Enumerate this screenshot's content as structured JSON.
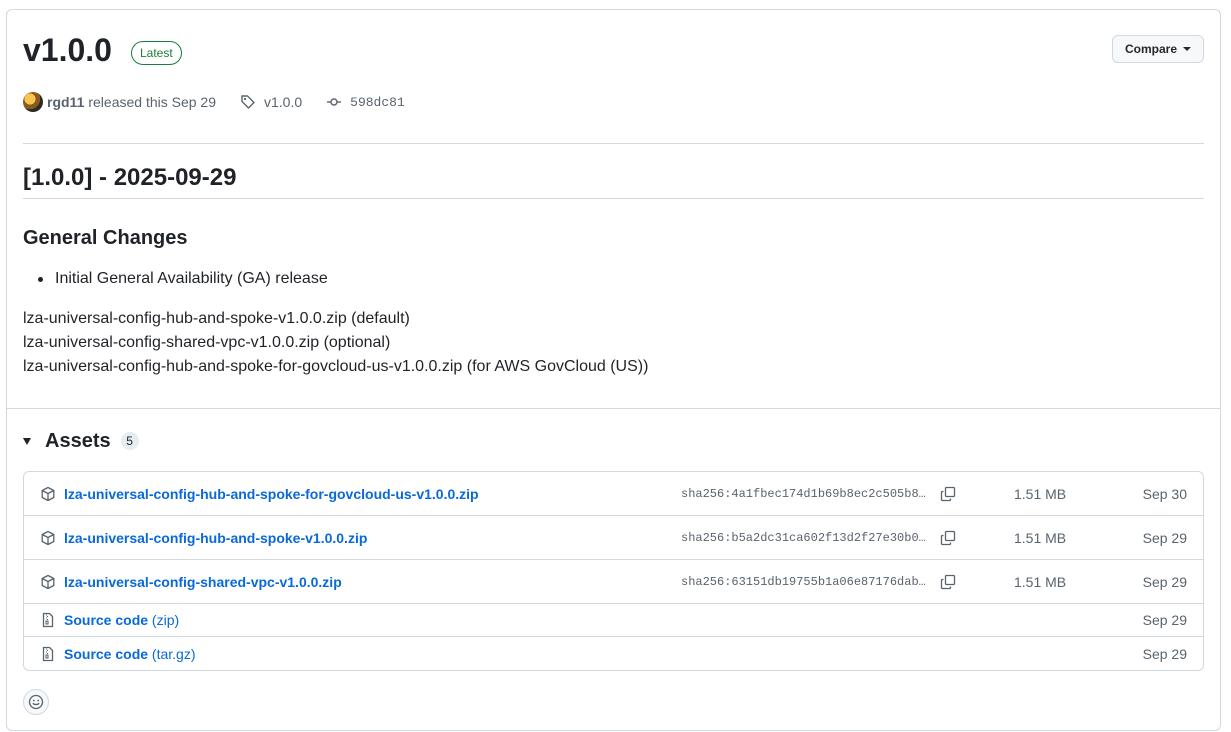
{
  "release": {
    "version": "v1.0.0",
    "badge": "Latest",
    "compare_label": "Compare",
    "author": "rgd11",
    "released_text": "released this Sep 29",
    "tag": "v1.0.0",
    "commit": "598dc81"
  },
  "notes": {
    "heading": "[1.0.0] - 2025-09-29",
    "section_heading": "General Changes",
    "bullets": [
      "Initial General Availability (GA) release"
    ],
    "lines": [
      "lza-universal-config-hub-and-spoke-v1.0.0.zip (default)",
      "lza-universal-config-shared-vpc-v1.0.0.zip (optional)",
      "lza-universal-config-hub-and-spoke-for-govcloud-us-v1.0.0.zip (for AWS GovCloud (US))"
    ]
  },
  "assets": {
    "title": "Assets",
    "count": "5",
    "items": [
      {
        "name": "lza-universal-config-hub-and-spoke-for-govcloud-us-v1.0.0.zip",
        "sha": "sha256:4a1fbec174d1b69b8ec2c505b8…",
        "size": "1.51 MB",
        "date": "Sep 30",
        "icon": "package-icon"
      },
      {
        "name": "lza-universal-config-hub-and-spoke-v1.0.0.zip",
        "sha": "sha256:b5a2dc31ca602f13d2f27e30b0…",
        "size": "1.51 MB",
        "date": "Sep 29",
        "icon": "package-icon"
      },
      {
        "name": "lza-universal-config-shared-vpc-v1.0.0.zip",
        "sha": "sha256:63151db19755b1a06e87176dab…",
        "size": "1.51 MB",
        "date": "Sep 29",
        "icon": "package-icon"
      }
    ],
    "source": [
      {
        "name": "Source code",
        "suffix": "(zip)",
        "date": "Sep 29",
        "icon": "file-zip-icon"
      },
      {
        "name": "Source code",
        "suffix": "(tar.gz)",
        "date": "Sep 29",
        "icon": "file-zip-icon"
      }
    ]
  },
  "colors": {
    "accent": "#0969da",
    "latest_green": "#1a7f37",
    "border": "#d1d9e0",
    "muted": "#59636e"
  }
}
